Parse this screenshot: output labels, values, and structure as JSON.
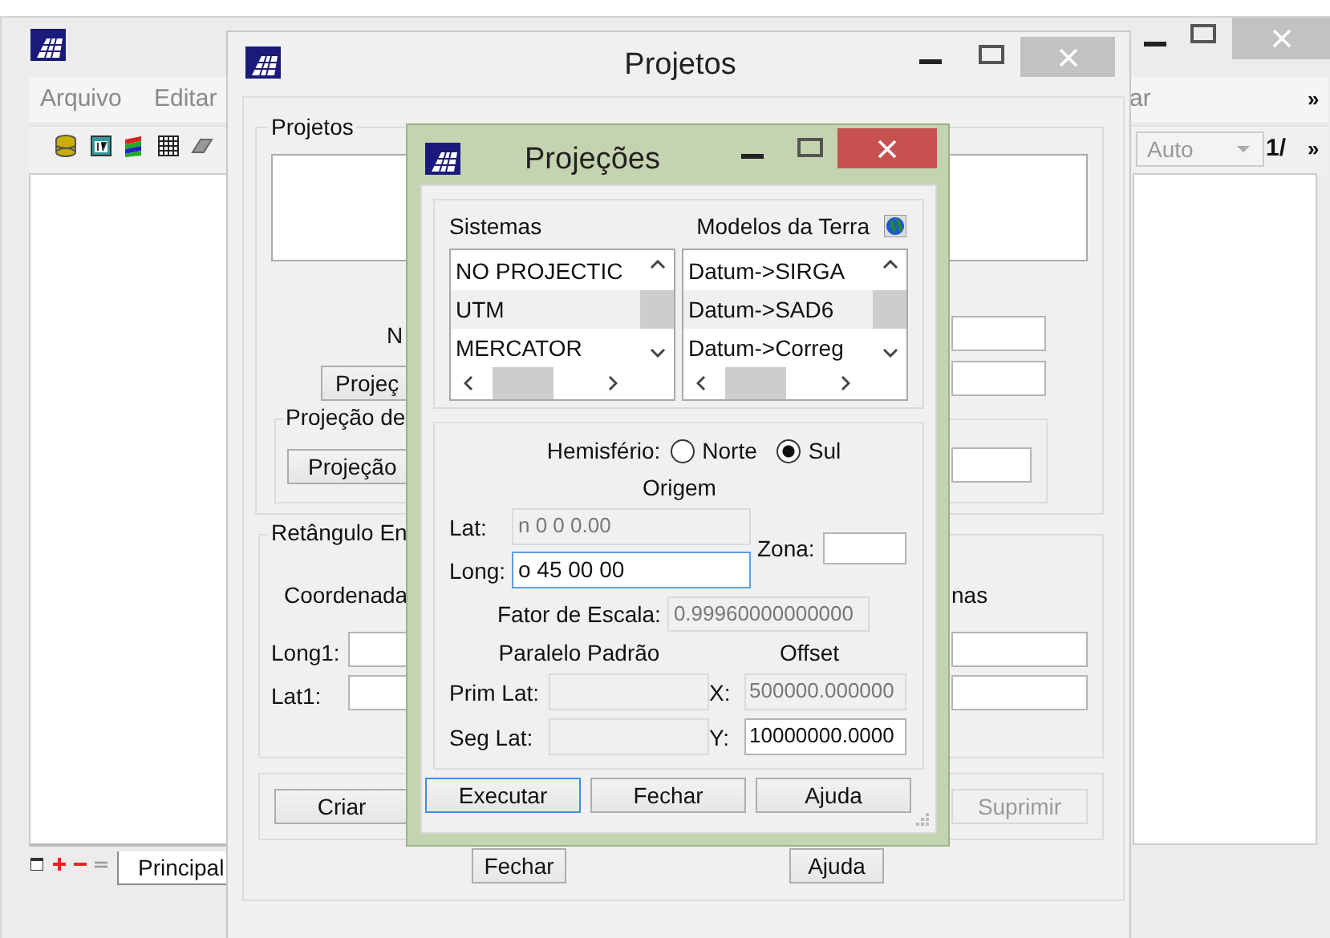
{
  "main_window": {
    "menu": [
      "Arquivo",
      "Editar",
      "ar"
    ],
    "menu_more": "»",
    "zoom_combo": {
      "value": "Auto",
      "disabled": true
    },
    "page_field": "1/",
    "toolbar_more": "»",
    "tabs": [
      {
        "label": "Principal",
        "selected": true
      }
    ]
  },
  "projetos_window": {
    "title": "Projetos",
    "list_group": "Projetos",
    "name_label": "N",
    "projection_button": "Projeç",
    "projection_group": "Projeção de",
    "projection_group_button": "Projeção",
    "rect_group": "Retângulo En",
    "coord_label": "Coordenada",
    "coord_label_right": "nas",
    "fields": [
      {
        "label": "Long1:"
      },
      {
        "label": "Lat1:"
      }
    ],
    "action_buttons": [
      {
        "label": "Criar",
        "disabled": false
      },
      {
        "label": "Suprimir",
        "disabled": true
      }
    ],
    "footer_buttons": [
      "Fechar",
      "Ajuda"
    ]
  },
  "projecoes_dialog": {
    "title": "Projeções",
    "systems": {
      "label": "Sistemas",
      "items": [
        {
          "label": "NO PROJECTIC",
          "selected": false
        },
        {
          "label": "UTM",
          "selected": true
        },
        {
          "label": "MERCATOR",
          "selected": false
        }
      ]
    },
    "earth_models": {
      "label": "Modelos da Terra",
      "items": [
        {
          "label": "Datum->SIRGA",
          "selected": false
        },
        {
          "label": "Datum->SAD6",
          "selected": true
        },
        {
          "label": "Datum->Correg",
          "selected": false
        }
      ]
    },
    "hemisphere": {
      "label": "Hemisfério:",
      "options": [
        {
          "label": "Norte",
          "selected": false
        },
        {
          "label": "Sul",
          "selected": true
        }
      ]
    },
    "origin_label": "Origem",
    "lat": {
      "label": "Lat:",
      "value": "n 0 0 0.00",
      "disabled": true,
      "focused": false
    },
    "long": {
      "label": "Long:",
      "value": "o 45 00 00",
      "disabled": false,
      "focused": true
    },
    "zone": {
      "label": "Zona:",
      "disabled": false,
      "focused": false
    },
    "scale_factor": {
      "label": "Fator de Escala:",
      "value": "0.99960000000000",
      "disabled": true,
      "focused": false
    },
    "standard_parallel_label": "Paralelo Padrão",
    "offset_label": "Offset",
    "prim_lat": {
      "label": "Prim Lat:",
      "disabled": true,
      "focused": false
    },
    "offset_x": {
      "label": "X:",
      "value": "500000.000000",
      "disabled": true,
      "focused": false
    },
    "seg_lat": {
      "label": "Seg Lat:",
      "disabled": true,
      "focused": false
    },
    "offset_y": {
      "label": "Y:",
      "value": "10000000.0000",
      "disabled": false,
      "focused": false
    },
    "buttons": [
      {
        "label": "Executar",
        "focused": true
      },
      {
        "label": "Fechar",
        "focused": false
      },
      {
        "label": "Ajuda",
        "focused": false
      }
    ]
  }
}
